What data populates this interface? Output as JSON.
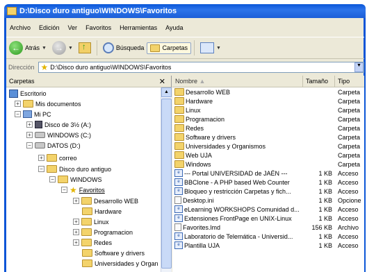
{
  "window": {
    "title": "D:\\Disco duro antiguo\\WINDOWS\\Favoritos"
  },
  "menu": [
    "Archivo",
    "Edición",
    "Ver",
    "Favoritos",
    "Herramientas",
    "Ayuda"
  ],
  "toolbar": {
    "back_label": "Atrás",
    "search_label": "Búsqueda",
    "folders_label": "Carpetas"
  },
  "address": {
    "label": "Dirección",
    "value": "D:\\Disco duro antiguo\\WINDOWS\\Favoritos"
  },
  "tree_pane": {
    "title": "Carpetas",
    "close": "✕",
    "items": [
      {
        "label": "Escritorio"
      },
      {
        "label": "Mis documentos"
      },
      {
        "label": "Mi PC"
      },
      {
        "label": "Disco de 3½ (A:)"
      },
      {
        "label": "WINDOWS (C:)"
      },
      {
        "label": "DATOS (D:)"
      },
      {
        "label": "correo"
      },
      {
        "label": "Disco duro antiguo"
      },
      {
        "label": "WINDOWS"
      },
      {
        "label": "Favoritos"
      },
      {
        "label": "Desarrollo WEB"
      },
      {
        "label": "Hardware"
      },
      {
        "label": "Linux"
      },
      {
        "label": "Programacion"
      },
      {
        "label": "Redes"
      },
      {
        "label": "Software y drivers"
      },
      {
        "label": "Universidades y Organ"
      }
    ]
  },
  "list": {
    "columns": {
      "name": "Nombre",
      "size": "Tamaño",
      "type": "Tipo"
    },
    "rows": [
      {
        "name": "Desarrollo WEB",
        "size": "",
        "type": "Carpeta",
        "icon": "folder"
      },
      {
        "name": "Hardware",
        "size": "",
        "type": "Carpeta",
        "icon": "folder"
      },
      {
        "name": "Linux",
        "size": "",
        "type": "Carpeta",
        "icon": "folder"
      },
      {
        "name": "Programacion",
        "size": "",
        "type": "Carpeta",
        "icon": "folder"
      },
      {
        "name": "Redes",
        "size": "",
        "type": "Carpeta",
        "icon": "folder"
      },
      {
        "name": "Software y drivers",
        "size": "",
        "type": "Carpeta",
        "icon": "folder"
      },
      {
        "name": "Universidades y Organismos",
        "size": "",
        "type": "Carpeta",
        "icon": "folder"
      },
      {
        "name": "Web UJA",
        "size": "",
        "type": "Carpeta",
        "icon": "folder"
      },
      {
        "name": "Windows",
        "size": "",
        "type": "Carpeta",
        "icon": "folder"
      },
      {
        "name": "--- Portal UNIVERSIDAD de JAÉN ---",
        "size": "1 KB",
        "type": "Acceso",
        "icon": "url"
      },
      {
        "name": "BBClone - A PHP based Web Counter",
        "size": "1 KB",
        "type": "Acceso",
        "icon": "url"
      },
      {
        "name": "Bloqueo y restricción  Carpetas y fich...",
        "size": "1 KB",
        "type": "Acceso",
        "icon": "url"
      },
      {
        "name": "Desktop.ini",
        "size": "1 KB",
        "type": "Opcione",
        "icon": "doc"
      },
      {
        "name": "eLearning WORKSHOPS Comunidad d...",
        "size": "1 KB",
        "type": "Acceso",
        "icon": "url"
      },
      {
        "name": "Extensiones FrontPage en UNIX-Linux",
        "size": "1 KB",
        "type": "Acceso",
        "icon": "url"
      },
      {
        "name": "Favorites.lmd",
        "size": "156 KB",
        "type": "Archivo",
        "icon": "doc"
      },
      {
        "name": "Laboratorio de Telemática - Universid...",
        "size": "1 KB",
        "type": "Acceso",
        "icon": "url"
      },
      {
        "name": "Plantilla UJA",
        "size": "1 KB",
        "type": "Acceso",
        "icon": "url"
      }
    ]
  }
}
